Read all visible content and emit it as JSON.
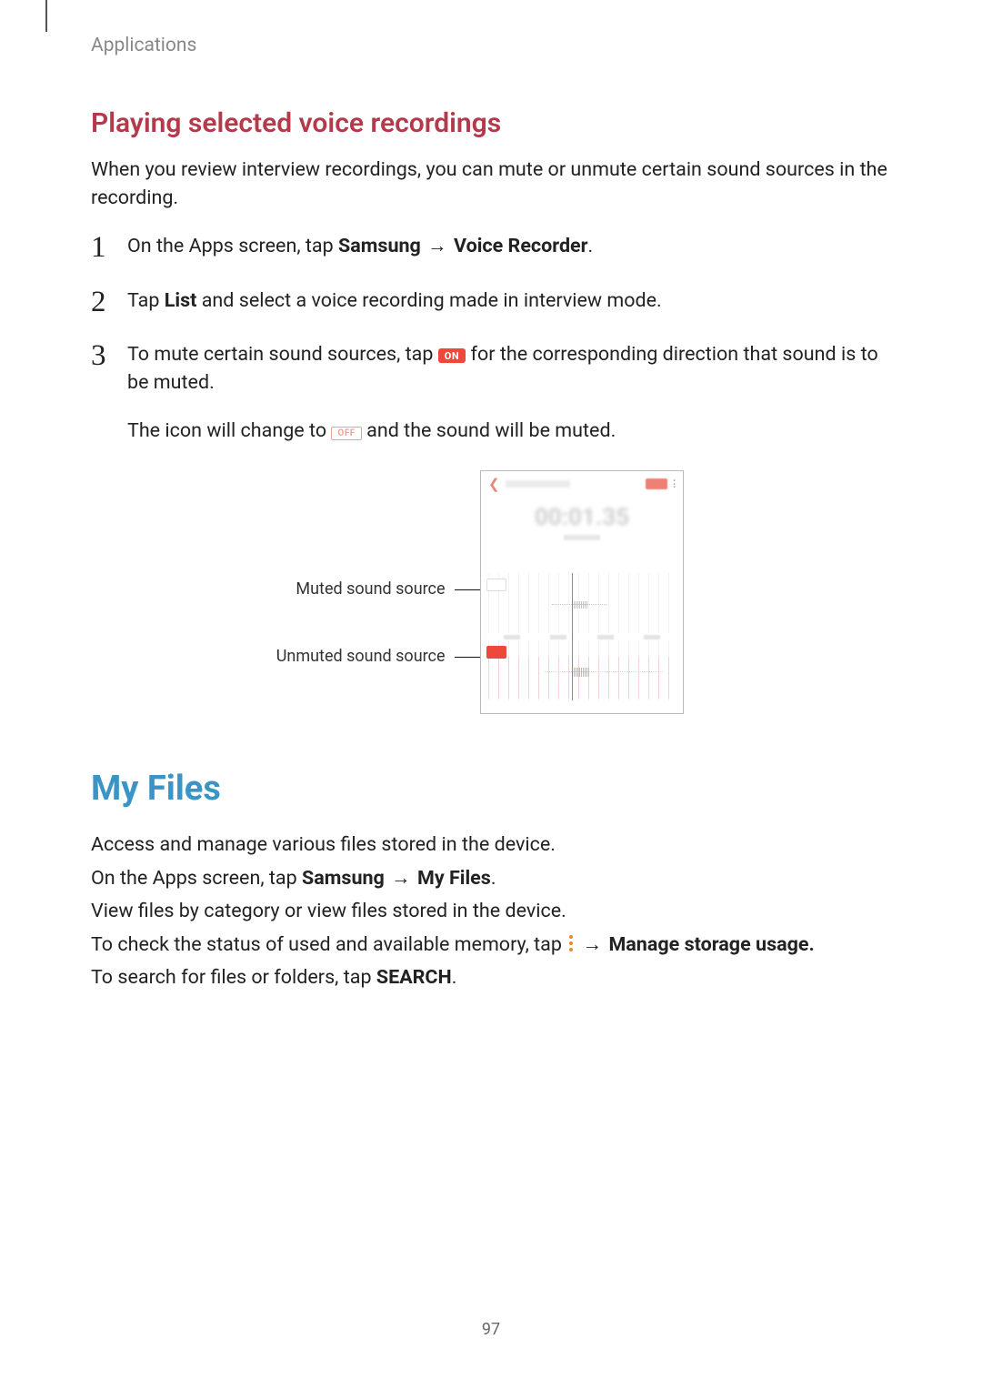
{
  "breadcrumb": "Applications",
  "section1": {
    "title": "Playing selected voice recordings",
    "intro": "When you review interview recordings, you can mute or unmute certain sound sources in the recording.",
    "steps": {
      "s1": {
        "pre": "On the Apps screen, tap ",
        "b1": "Samsung",
        "arrow": " → ",
        "b2": "Voice Recorder",
        "post": "."
      },
      "s2": {
        "pre": "Tap ",
        "b1": "List",
        "post": " and select a voice recording made in interview mode."
      },
      "s3": {
        "pre": "To mute certain sound sources, tap ",
        "on_label": "ON",
        "post": " for the corresponding direction that sound is to be muted.",
        "sub_pre": "The icon will change to ",
        "off_label": "OFF",
        "sub_post": " and the sound will be muted."
      }
    },
    "callouts": {
      "muted": "Muted sound source",
      "unmuted": "Unmuted sound source"
    },
    "phone": {
      "time": "00:01.35"
    }
  },
  "section2": {
    "title": "My Files",
    "p1": "Access and manage various files stored in the device.",
    "p2": {
      "pre": "On the Apps screen, tap ",
      "b1": "Samsung",
      "arrow": " → ",
      "b2": "My Files",
      "post": "."
    },
    "p3": "View files by category or view files stored in the device.",
    "p4": {
      "pre": "To check the status of used and available memory, tap ",
      "arrow": " → ",
      "b1": "Manage storage usage."
    },
    "p5": {
      "pre": "To search for files or folders, tap ",
      "b1": "SEARCH",
      "post": "."
    }
  },
  "page_number": "97"
}
